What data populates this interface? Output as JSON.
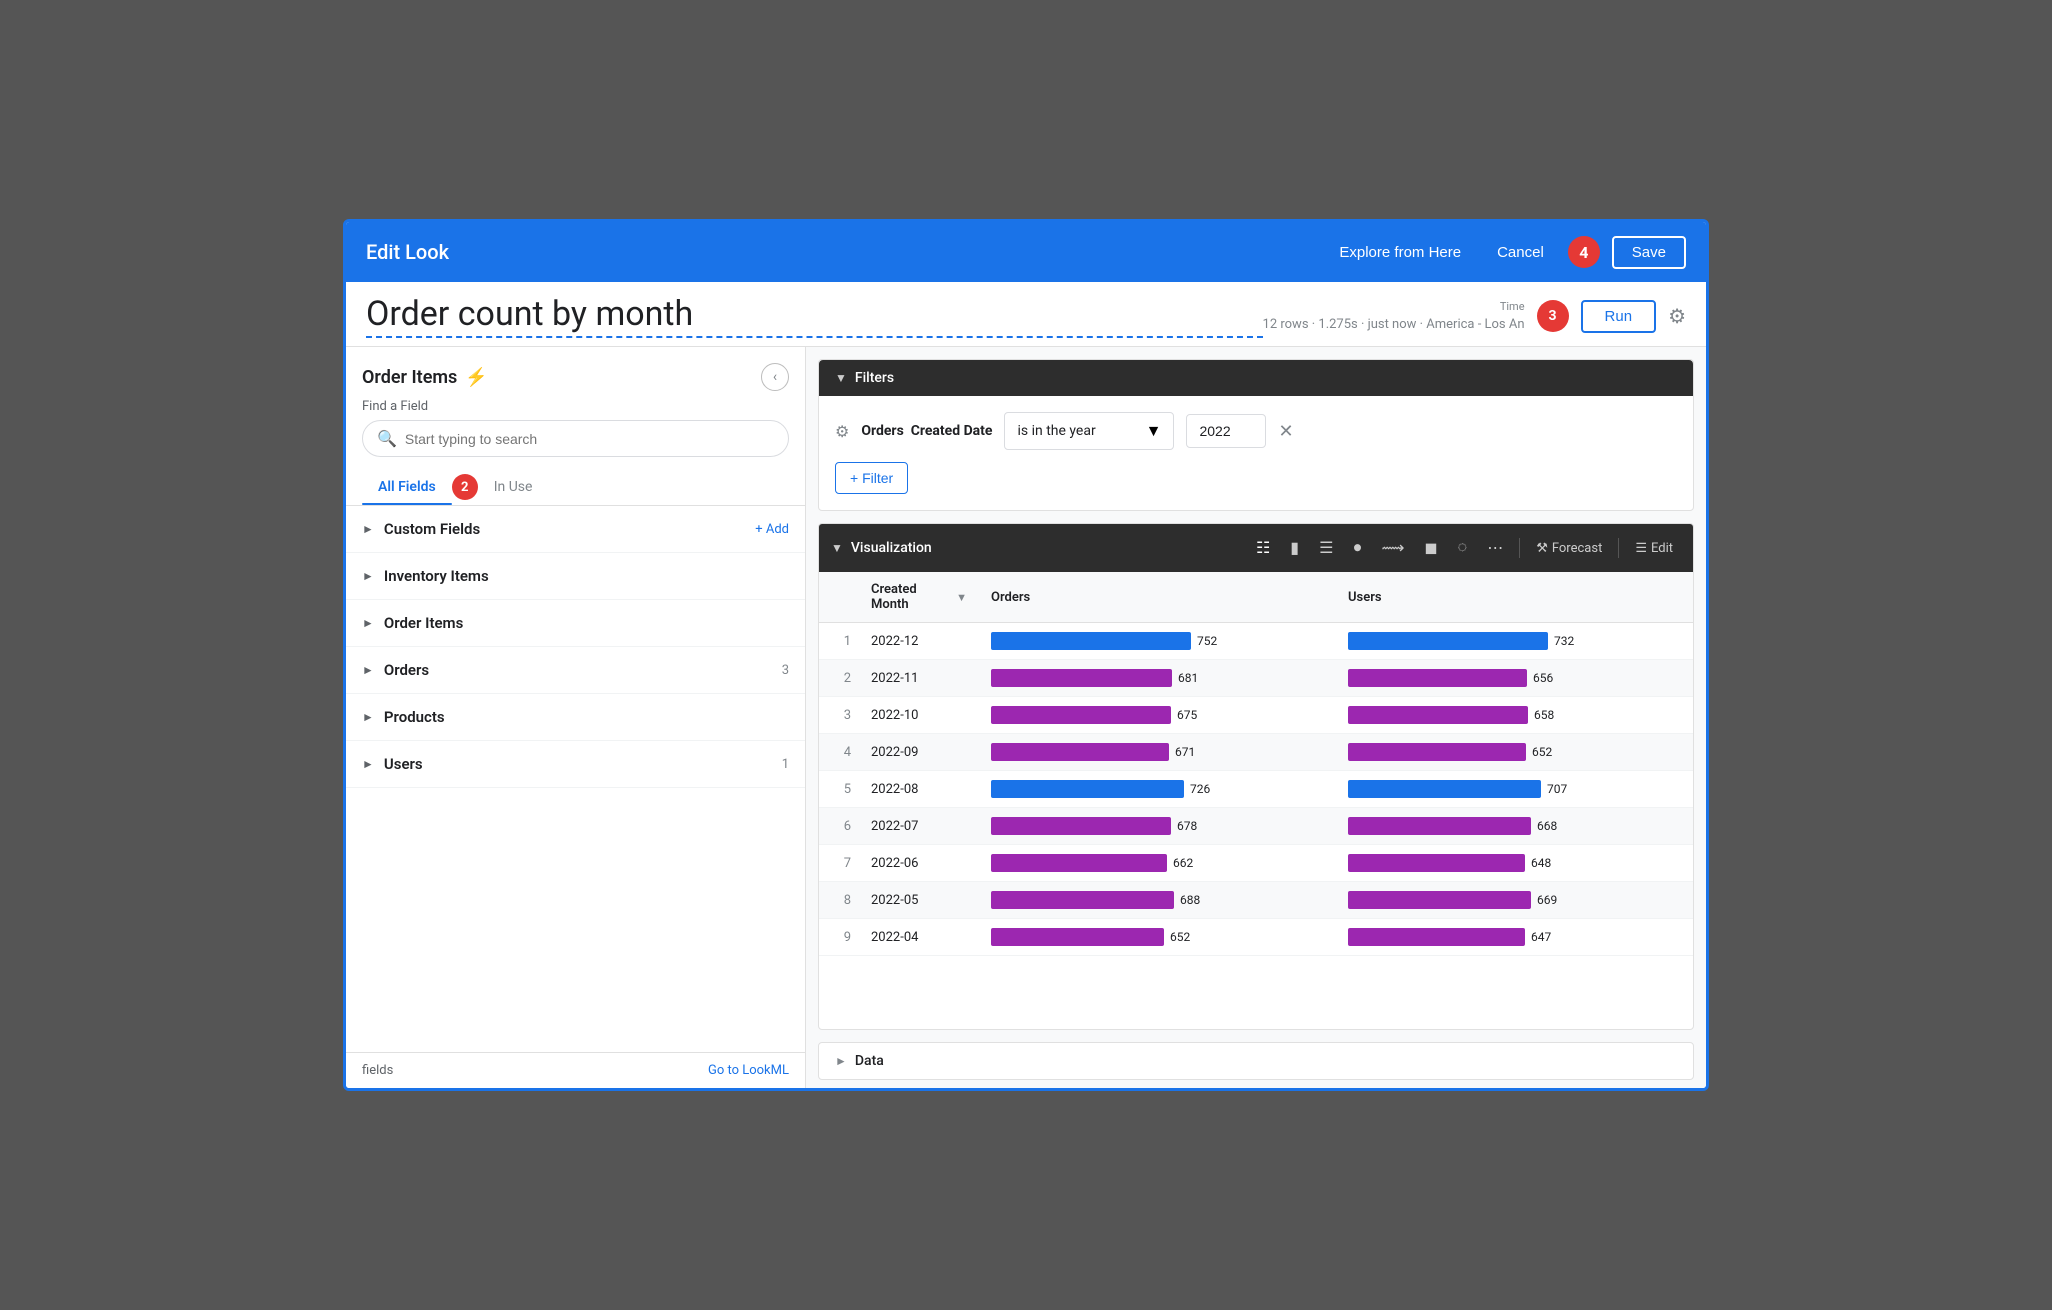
{
  "header": {
    "title": "Edit Look",
    "explore_btn": "Explore from Here",
    "cancel_btn": "Cancel",
    "save_btn": "Save",
    "badge4": "4"
  },
  "sub_header": {
    "title": "Order count by month",
    "meta": "12 rows · 1.275s · just now · America - Los An",
    "time_label": "Time",
    "run_btn": "Run"
  },
  "sidebar": {
    "title": "Order Items",
    "find_field_label": "Find a Field",
    "search_placeholder": "Start typing to search",
    "tabs": [
      {
        "label": "All Fields",
        "active": true
      },
      {
        "label": "In Use",
        "active": false
      }
    ],
    "badge2": "2",
    "groups": [
      {
        "name": "Custom Fields",
        "count": "",
        "add": "+ Add"
      },
      {
        "name": "Inventory Items",
        "count": "",
        "add": ""
      },
      {
        "name": "Order Items",
        "count": "",
        "add": ""
      },
      {
        "name": "Orders",
        "count": "3",
        "add": ""
      },
      {
        "name": "Products",
        "count": "",
        "add": ""
      },
      {
        "name": "Users",
        "count": "1",
        "add": ""
      }
    ],
    "footer_text": "fields",
    "footer_link": "Go to LookML"
  },
  "filters": {
    "section_title": "Filters",
    "filter_gear": "⚙",
    "filter_label_prefix": "Orders",
    "filter_label_bold": "Created Date",
    "filter_condition": "is in the year",
    "filter_value": "2022",
    "add_filter_btn": "+ Filter"
  },
  "visualization": {
    "section_title": "Visualization",
    "forecast_btn": "Forecast",
    "edit_btn": "Edit",
    "columns": [
      {
        "label": "Created Month"
      },
      {
        "label": "Orders"
      },
      {
        "label": "Users"
      }
    ],
    "rows": [
      {
        "num": 1,
        "month": "2022-12",
        "orders": 752,
        "orders_pct": 100,
        "orders_color": "#1a73e8",
        "users": 732,
        "users_pct": 97,
        "users_color": "#1a73e8"
      },
      {
        "num": 2,
        "month": "2022-11",
        "orders": 681,
        "orders_pct": 90,
        "orders_color": "#9c27b0",
        "users": 656,
        "users_pct": 87,
        "users_color": "#9c27b0"
      },
      {
        "num": 3,
        "month": "2022-10",
        "orders": 675,
        "orders_pct": 89,
        "orders_color": "#9c27b0",
        "users": 658,
        "users_pct": 87,
        "users_color": "#9c27b0"
      },
      {
        "num": 4,
        "month": "2022-09",
        "orders": 671,
        "orders_pct": 89,
        "orders_color": "#9c27b0",
        "users": 652,
        "users_pct": 86,
        "users_color": "#9c27b0"
      },
      {
        "num": 5,
        "month": "2022-08",
        "orders": 726,
        "orders_pct": 96,
        "orders_color": "#1a73e8",
        "users": 707,
        "users_pct": 94,
        "users_color": "#1a73e8"
      },
      {
        "num": 6,
        "month": "2022-07",
        "orders": 678,
        "orders_pct": 90,
        "orders_color": "#9c27b0",
        "users": 668,
        "users_pct": 88,
        "users_color": "#9c27b0"
      },
      {
        "num": 7,
        "month": "2022-06",
        "orders": 662,
        "orders_pct": 87,
        "orders_color": "#9c27b0",
        "users": 648,
        "users_pct": 86,
        "users_color": "#9c27b0"
      },
      {
        "num": 8,
        "month": "2022-05",
        "orders": 688,
        "orders_pct": 91,
        "orders_color": "#9c27b0",
        "users": 669,
        "users_pct": 88,
        "users_color": "#9c27b0"
      },
      {
        "num": 9,
        "month": "2022-04",
        "orders": 652,
        "orders_pct": 86,
        "orders_color": "#9c27b0",
        "users": 647,
        "users_pct": 85,
        "users_color": "#9c27b0"
      }
    ]
  },
  "data_section": {
    "label": "Data"
  }
}
